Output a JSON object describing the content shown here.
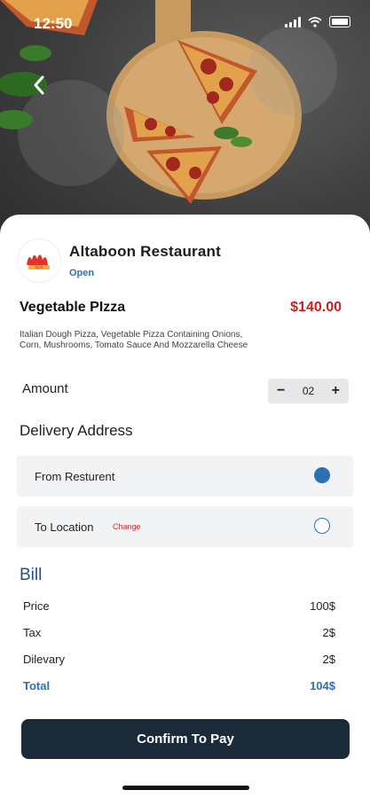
{
  "status_bar": {
    "time": "12:50"
  },
  "restaurant": {
    "name": "Altaboon Restaurant",
    "status": "Open"
  },
  "item": {
    "name": "Vegetable PIzza",
    "price": "$140.00",
    "description": "Italian Dough Pizza, Vegetable Pizza Containing Onions, Corn, Mushrooms, Tomato Sauce And Mozzarella Cheese"
  },
  "amount": {
    "label": "Amount",
    "value": "02",
    "minus": "−",
    "plus": "+"
  },
  "delivery": {
    "title": "Delivery Address",
    "options": [
      {
        "label": "From Resturent",
        "selected": true
      },
      {
        "label": "To Location",
        "action": "Change",
        "selected": false
      }
    ]
  },
  "bill": {
    "title": "Bill",
    "rows": [
      {
        "label": "Price",
        "value": "100$"
      },
      {
        "label": "Tax",
        "value": "2$"
      },
      {
        "label": "Dilevary",
        "value": "2$"
      },
      {
        "label": "Total",
        "value": "104$"
      }
    ]
  },
  "confirm_label": "Confirm To Pay",
  "colors": {
    "accent": "#2f6fb5",
    "price": "#cc1f1f",
    "button": "#1b2a38"
  },
  "icons": [
    "back-arrow-icon",
    "signal-icon",
    "wifi-icon",
    "battery-icon",
    "restaurant-logo-icon",
    "radio-selected-icon",
    "radio-empty-icon"
  ]
}
